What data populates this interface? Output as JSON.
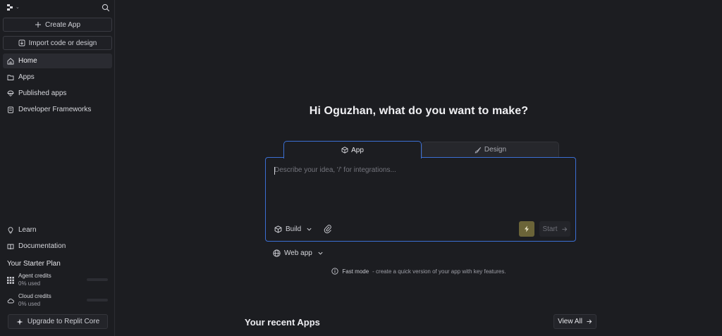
{
  "sidebar": {
    "create_app": "Create App",
    "import": "Import code or design",
    "nav": [
      {
        "label": "Home",
        "icon": "home-icon",
        "active": true
      },
      {
        "label": "Apps",
        "icon": "folder-icon",
        "active": false
      },
      {
        "label": "Published apps",
        "icon": "balloon-icon",
        "active": false
      },
      {
        "label": "Developer Frameworks",
        "icon": "frameworks-icon",
        "active": false
      }
    ],
    "bottom_nav": [
      {
        "label": "Learn",
        "icon": "lightbulb-icon"
      },
      {
        "label": "Documentation",
        "icon": "book-icon"
      }
    ],
    "plan_title": "Your Starter Plan",
    "credits": [
      {
        "name": "Agent credits",
        "used": "0% used",
        "fraction": 0
      },
      {
        "name": "Cloud credits",
        "used": "0% used",
        "fraction": 0
      }
    ],
    "upgrade": "Upgrade to Replit Core"
  },
  "main": {
    "greeting": "Hi Oguzhan, what do you want to make?",
    "tabs": [
      {
        "label": "App",
        "icon": "cube-icon",
        "active": true
      },
      {
        "label": "Design",
        "icon": "brush-icon",
        "active": false
      }
    ],
    "prompt_placeholder": "Describe your idea, '/' for integrations...",
    "build_label": "Build",
    "start_label": "Start",
    "web_app": "Web app",
    "fast_mode_label": "Fast mode",
    "fast_mode_desc": "- create a quick version of your app with key features.",
    "recent_title": "Your recent Apps",
    "view_all": "View All"
  },
  "colors": {
    "background": "#1c1d21",
    "accent_blue": "#3b6fd4",
    "bolt_bg": "#6b6438"
  }
}
